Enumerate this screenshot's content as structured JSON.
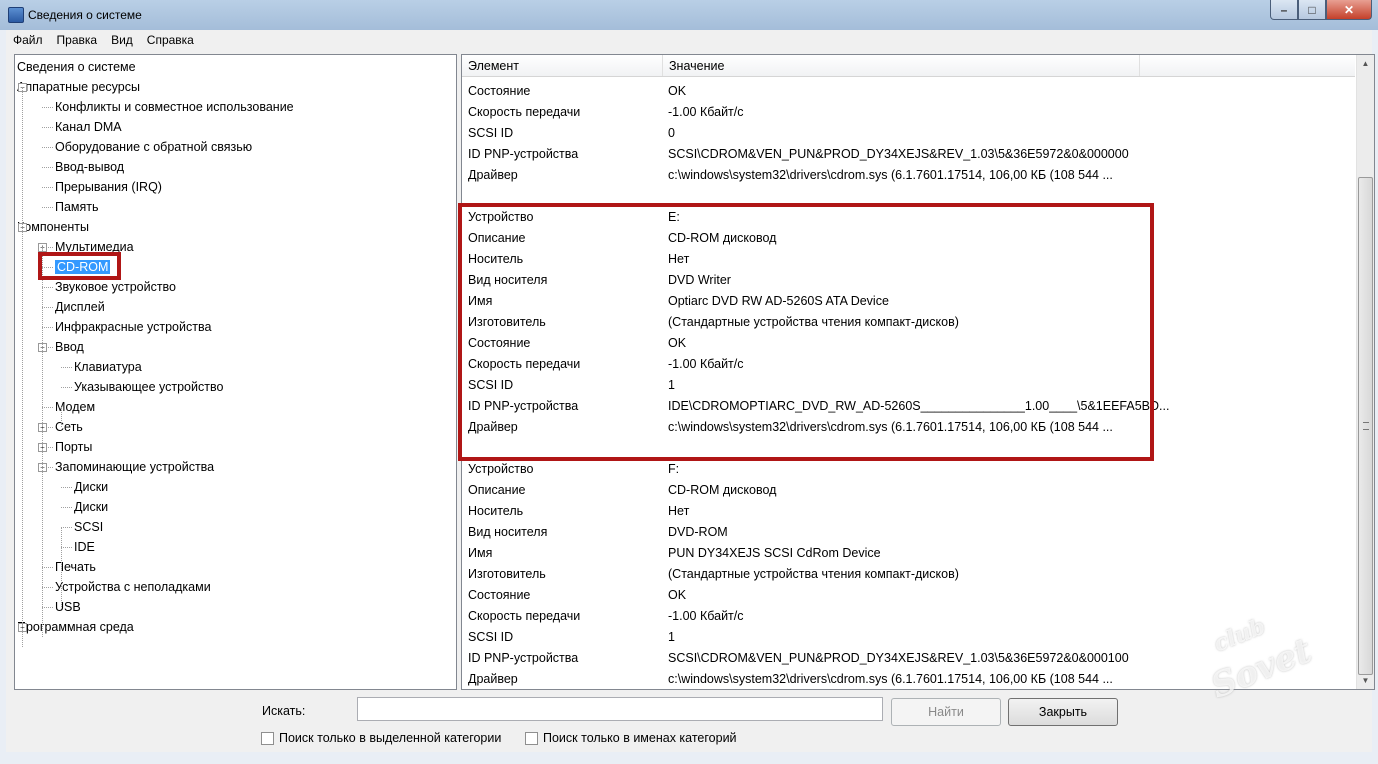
{
  "window": {
    "title": "Сведения о системе",
    "min": "–",
    "max": "□",
    "close": "✕"
  },
  "menu": [
    "Файл",
    "Правка",
    "Вид",
    "Справка"
  ],
  "tree": [
    {
      "label": "Сведения о системе",
      "level": 0,
      "expander": null
    },
    {
      "label": "Аппаратные ресурсы",
      "level": 0,
      "expander": "minus"
    },
    {
      "label": "Конфликты и совместное использование",
      "level": 1,
      "expander": null
    },
    {
      "label": "Канал DMA",
      "level": 1,
      "expander": null
    },
    {
      "label": "Оборудование с обратной связью",
      "level": 1,
      "expander": null
    },
    {
      "label": "Ввод-вывод",
      "level": 1,
      "expander": null
    },
    {
      "label": "Прерывания (IRQ)",
      "level": 1,
      "expander": null
    },
    {
      "label": "Память",
      "level": 1,
      "expander": null
    },
    {
      "label": "Компоненты",
      "level": 0,
      "expander": "minus"
    },
    {
      "label": "Мультимедиа",
      "level": 1,
      "expander": "plus"
    },
    {
      "label": "CD-ROM",
      "level": 1,
      "expander": null,
      "selected": true
    },
    {
      "label": "Звуковое устройство",
      "level": 1,
      "expander": null
    },
    {
      "label": "Дисплей",
      "level": 1,
      "expander": null
    },
    {
      "label": "Инфракрасные устройства",
      "level": 1,
      "expander": null
    },
    {
      "label": "Ввод",
      "level": 1,
      "expander": "minus"
    },
    {
      "label": "Клавиатура",
      "level": 2,
      "expander": null
    },
    {
      "label": "Указывающее устройство",
      "level": 2,
      "expander": null
    },
    {
      "label": "Модем",
      "level": 1,
      "expander": null
    },
    {
      "label": "Сеть",
      "level": 1,
      "expander": "plus"
    },
    {
      "label": "Порты",
      "level": 1,
      "expander": "plus"
    },
    {
      "label": "Запоминающие устройства",
      "level": 1,
      "expander": "minus"
    },
    {
      "label": "Диски",
      "level": 2,
      "expander": null
    },
    {
      "label": "Диски",
      "level": 2,
      "expander": null
    },
    {
      "label": "SCSI",
      "level": 2,
      "expander": null
    },
    {
      "label": "IDE",
      "level": 2,
      "expander": null
    },
    {
      "label": "Печать",
      "level": 1,
      "expander": null
    },
    {
      "label": "Устройства с неполадками",
      "level": 1,
      "expander": null
    },
    {
      "label": "USB",
      "level": 1,
      "expander": null
    },
    {
      "label": "Программная среда",
      "level": 0,
      "expander": "plus"
    }
  ],
  "list": {
    "headers": [
      "Элемент",
      "Значение"
    ],
    "rows": [
      [
        "Состояние",
        "OK"
      ],
      [
        "Скорость передачи",
        "-1.00 Кбайт/с"
      ],
      [
        "SCSI ID",
        "0"
      ],
      [
        "ID PNP-устройства",
        "SCSI\\CDROM&VEN_PUN&PROD_DY34XEJS&REV_1.03\\5&36E5972&0&000000"
      ],
      [
        "Драйвер",
        "c:\\windows\\system32\\drivers\\cdrom.sys (6.1.7601.17514, 106,00 КБ (108 544 ..."
      ],
      [
        "",
        ""
      ],
      [
        "Устройство",
        "E:"
      ],
      [
        "Описание",
        "CD-ROM дисковод"
      ],
      [
        "Носитель",
        "Нет"
      ],
      [
        "Вид носителя",
        "DVD Writer"
      ],
      [
        "Имя",
        "Optiarc DVD RW AD-5260S ATA Device"
      ],
      [
        "Изготовитель",
        "(Стандартные устройства чтения компакт-дисков)"
      ],
      [
        "Состояние",
        "OK"
      ],
      [
        "Скорость передачи",
        "-1.00 Кбайт/с"
      ],
      [
        "SCSI ID",
        "1"
      ],
      [
        "ID PNP-устройства",
        "IDE\\CDROMOPTIARC_DVD_RW_AD-5260S_______________1.00____\\5&1EEFA5BD..."
      ],
      [
        "Драйвер",
        "c:\\windows\\system32\\drivers\\cdrom.sys (6.1.7601.17514, 106,00 КБ (108 544 ..."
      ],
      [
        "",
        ""
      ],
      [
        "Устройство",
        "F:"
      ],
      [
        "Описание",
        "CD-ROM дисковод"
      ],
      [
        "Носитель",
        "Нет"
      ],
      [
        "Вид носителя",
        "DVD-ROM"
      ],
      [
        "Имя",
        "PUN DY34XEJS SCSI CdRom Device"
      ],
      [
        "Изготовитель",
        "(Стандартные устройства чтения компакт-дисков)"
      ],
      [
        "Состояние",
        "OK"
      ],
      [
        "Скорость передачи",
        "-1.00 Кбайт/с"
      ],
      [
        "SCSI ID",
        "1"
      ],
      [
        "ID PNP-устройства",
        "SCSI\\CDROM&VEN_PUN&PROD_DY34XEJS&REV_1.03\\5&36E5972&0&000100"
      ],
      [
        "Драйвер",
        "c:\\windows\\system32\\drivers\\cdrom.sys (6.1.7601.17514, 106,00 КБ (108 544 ..."
      ]
    ]
  },
  "search": {
    "label": "Искать:",
    "value": "",
    "find_label": "Найти",
    "close_label": "Закрыть",
    "check_selected": "Поиск только в выделенной категории",
    "check_names": "Поиск только в именах категорий"
  },
  "watermark": {
    "line1": "club",
    "line2": "Sovet"
  },
  "colors": {
    "highlight_box": "#b01616",
    "selection": "#3399ff"
  }
}
